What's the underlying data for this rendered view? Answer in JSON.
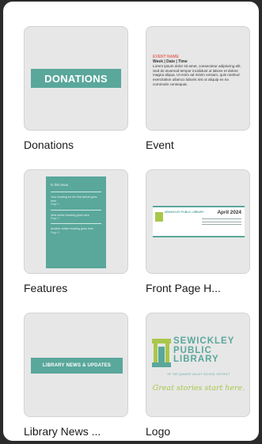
{
  "templates": [
    {
      "caption": "Donations",
      "preview": {
        "banner": "DONATIONS"
      }
    },
    {
      "caption": "Event",
      "preview": {
        "title": "EVENT NAME",
        "subtitle": "Week | Date | Time",
        "body": "Lorem ipsum dolor sit amet, consectetur adipiscing elit. Sed do eiusmod tempor incididunt ut labore et dolore magna aliqua. Ut enim ad minim veniam, quis nostrud exercitation ullamco laboris nisi ut aliquip ex ea commodo consequat."
      }
    },
    {
      "caption": "Features",
      "preview": {
        "heading": "In this issue",
        "items": [
          {
            "text": "Your heading for the first article goes here",
            "page": "Page 1"
          },
          {
            "text": "Next article heading goes here",
            "page": "Page 2"
          },
          {
            "text": "Another article heading goes here",
            "page": "Page 3"
          }
        ]
      }
    },
    {
      "caption": "Front Page H...",
      "preview": {
        "library": "SEWICKLEY PUBLIC LIBRARY",
        "month": "April 2024"
      }
    },
    {
      "caption": "Library News ...",
      "preview": {
        "banner": "LIBRARY NEWS & UPDATES"
      }
    },
    {
      "caption": "Logo",
      "preview": {
        "line1": "SEWICKLEY",
        "line2": "PUBLIC",
        "line3": "LIBRARY",
        "tagline": "OF THE QUAKER VALLEY SCHOOL DISTRICT",
        "slogan": "Great stories start here."
      }
    }
  ],
  "colors": {
    "accent": "#5aa79b",
    "lime": "#a9c74a",
    "event_red": "#e26b5e",
    "thumb_bg": "#e7e7e7"
  }
}
